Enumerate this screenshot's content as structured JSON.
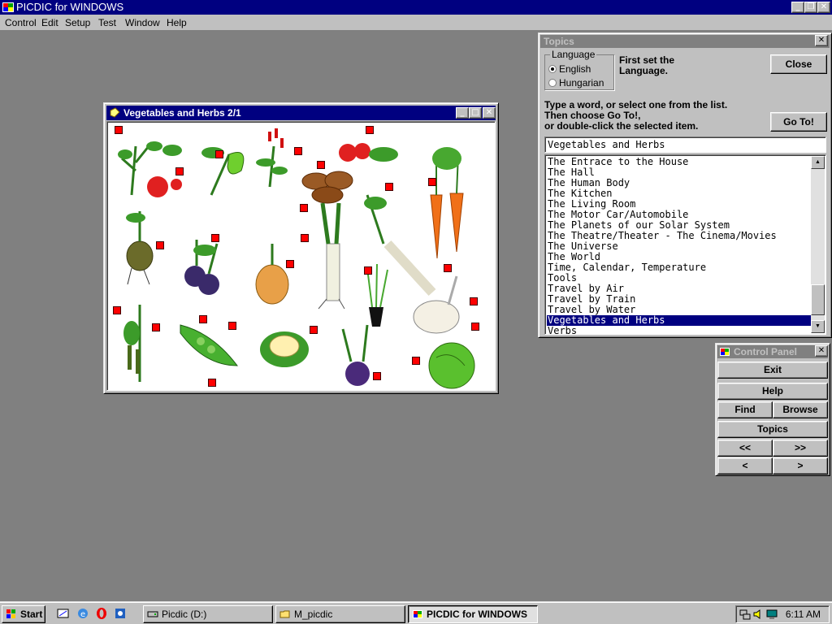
{
  "app": {
    "title": "PICDIC for WINDOWS",
    "menu": [
      "Control",
      "Edit",
      "Setup",
      "Test",
      "Window",
      "Help"
    ]
  },
  "vegetables_window": {
    "title": "Vegetables and Herbs 2/1"
  },
  "topics": {
    "title": "Topics",
    "language_group": "Language",
    "languages": [
      "English",
      "Hungarian"
    ],
    "selected_language": "English",
    "language_hint": "First set the Language.",
    "close_label": "Close",
    "instructions": [
      "Type a word, or select one from the list.",
      "Then choose Go To!,",
      "or double-click the selected item."
    ],
    "goto_label": "Go To!",
    "input_value": "Vegetables and Herbs",
    "items": [
      "The Entrace to the House",
      "The Hall",
      "The Human Body",
      "The Kitchen",
      "The Living Room",
      "The Motor Car/Automobile",
      "The Planets of our Solar System",
      "The Theatre/Theater - The Cinema/Movies",
      "The Universe",
      "The World",
      "Time, Calendar, Temperature",
      "Tools",
      "Travel by Air",
      "Travel by Train",
      "Travel by Water",
      "Vegetables and Herbs",
      "Verbs"
    ],
    "selected_item": "Vegetables and Herbs"
  },
  "control_panel": {
    "title": "Control Panel",
    "exit": "Exit",
    "help": "Help",
    "find": "Find",
    "browse": "Browse",
    "topics": "Topics",
    "first": "<<",
    "last": ">>",
    "prev": "<",
    "next": ">"
  },
  "taskbar": {
    "start": "Start",
    "tasks": [
      "Picdic (D:)",
      "M_picdic",
      "PICDIC for WINDOWS"
    ],
    "active_task": "PICDIC for WINDOWS",
    "clock": "6:11 AM"
  },
  "colors": {
    "title_active": "#000080",
    "title_inactive": "#808080",
    "hotspot": "#ff0000",
    "desktop": "#808080"
  }
}
